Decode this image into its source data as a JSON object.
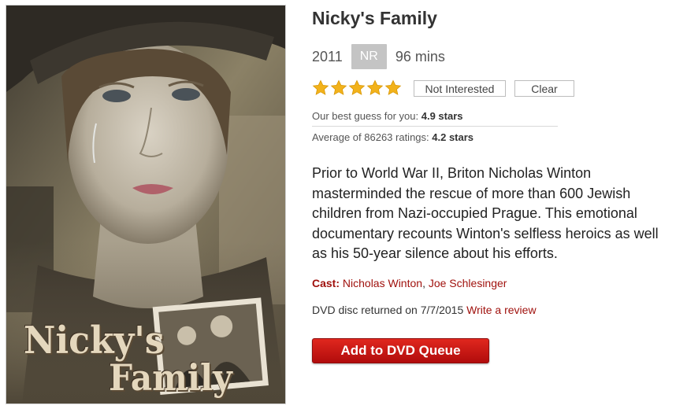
{
  "poster": {
    "title_line1": "Nicky's",
    "title_line2": "Family",
    "image_subject": "movie-poster-woman-with-hat-crying"
  },
  "movie": {
    "title": "Nicky's Family",
    "year": "2011",
    "rating": "NR",
    "duration": "96 mins",
    "user_stars": 5,
    "max_stars": 5
  },
  "buttons": {
    "not_interested": "Not Interested",
    "clear": "Clear",
    "add_queue": "Add to DVD Queue"
  },
  "guess": {
    "label": "Our best guess for you: ",
    "value": "4.9 stars"
  },
  "average": {
    "label": "Average of 86263 ratings: ",
    "value": "4.2 stars"
  },
  "synopsis": "Prior to World War II, Briton Nicholas Winton masterminded the rescue of more than 600 Jewish children from Nazi-occupied Prague. This emotional documentary recounts Winton's selfless heroics as well as his 50-year silence about his efforts.",
  "cast": {
    "label": "Cast:",
    "members": [
      "Nicholas Winton",
      "Joe Schlesinger"
    ],
    "separator": ", "
  },
  "history": {
    "text": "DVD disc returned on 7/7/2015 ",
    "review_link": "Write a review"
  },
  "colors": {
    "star": "#f2b21b",
    "link": "#a0120e",
    "button": "#c8140f",
    "badge": "#c4c4c4"
  }
}
